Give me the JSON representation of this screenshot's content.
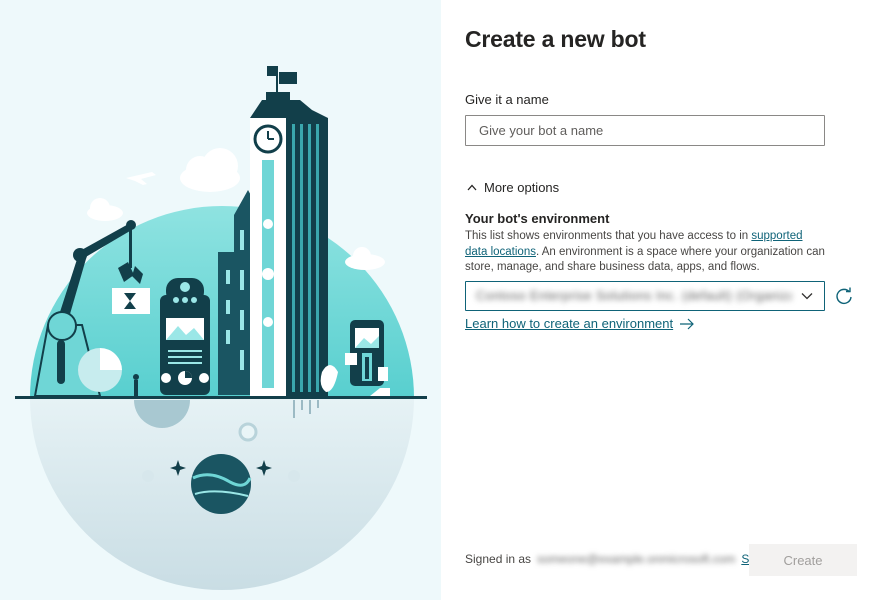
{
  "dialog": {
    "title": "Create a new bot",
    "name_label": "Give it a name",
    "name_placeholder": "Give your bot a name",
    "name_value": "",
    "more_options_label": "More options",
    "env_heading": "Your bot's environment",
    "env_desc_part1": "This list shows environments that you have access to in ",
    "env_desc_link": "supported data locations",
    "env_desc_part2": ". An environment is a space where your organization can store, manage, and share business data, apps, and flows.",
    "env_selected": "Contoso Enterprise Solutions Inc. (default) (Organization)",
    "learn_link": "Learn how to create an environment",
    "signed_in_label": "Signed in as",
    "signed_in_user": "someone@example.onmicrosoft.com",
    "sign_out": "Sign out",
    "create_button": "Create"
  },
  "icons": {
    "more_options": "chevron-up-icon",
    "dropdown": "chevron-down-icon",
    "refresh": "refresh-icon",
    "learn_link": "arrow-right-icon"
  },
  "colors": {
    "accent": "#0f6378",
    "illustration_teal": "#6fd6d6",
    "illustration_dark": "#0f3f4a",
    "left_background": "#eef9fb",
    "button_disabled_bg": "#f3f2f1",
    "button_disabled_text": "#a19f9d"
  }
}
